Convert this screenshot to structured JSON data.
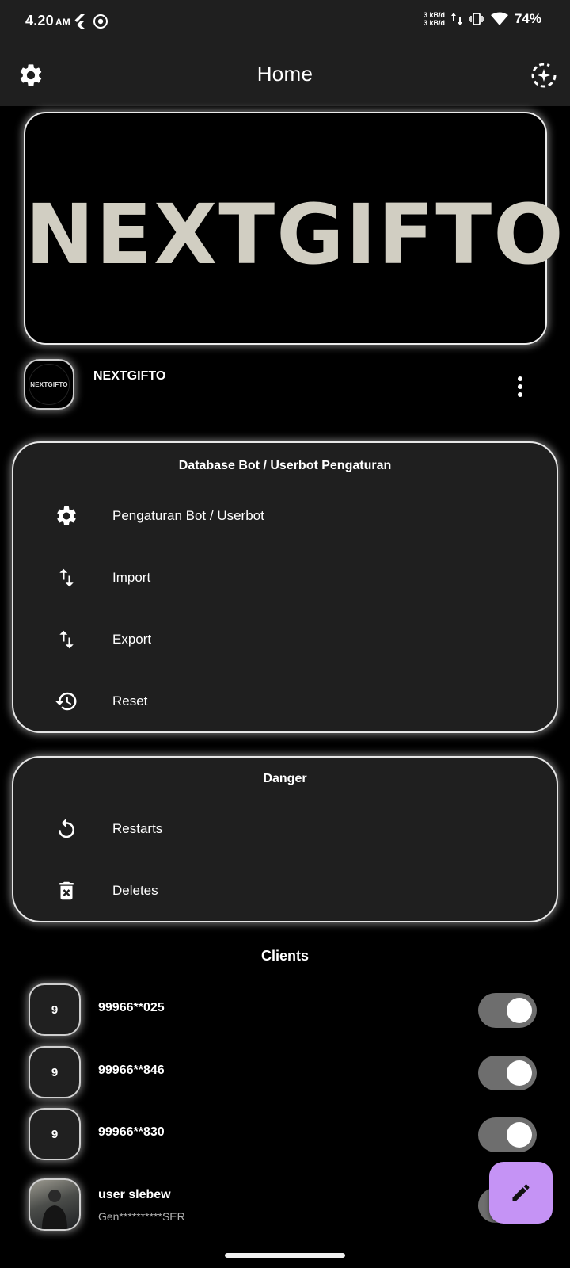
{
  "status_bar": {
    "time": "4.20",
    "ampm": "AM",
    "net_up": "3 kB/d",
    "net_down": "3 kB/d",
    "battery": "74%"
  },
  "app_bar": {
    "title": "Home",
    "left_icon": "settings-icon",
    "right_icon": "sparkle-refresh-icon"
  },
  "banner": {
    "logo_text": "NEXTGIFTO"
  },
  "profile": {
    "avatar_text": "NEXTGIFTO",
    "name": "NEXTGIFTO"
  },
  "database_card": {
    "title": "Database Bot / Userbot Pengaturan",
    "items": [
      {
        "label": "Pengaturan Bot / Userbot",
        "icon": "gear-icon"
      },
      {
        "label": "Import",
        "icon": "swap-vertical-icon"
      },
      {
        "label": "Export",
        "icon": "swap-vertical-icon"
      },
      {
        "label": "Reset",
        "icon": "history-icon"
      }
    ]
  },
  "danger_card": {
    "title": "Danger",
    "items": [
      {
        "label": "Restarts",
        "icon": "restart-icon"
      },
      {
        "label": "Deletes",
        "icon": "delete-icon"
      }
    ]
  },
  "clients": {
    "title": "Clients",
    "items": [
      {
        "badge": "9",
        "name": "99966**025",
        "sub": "",
        "enabled": true
      },
      {
        "badge": "9",
        "name": "99966**846",
        "sub": "",
        "enabled": true
      },
      {
        "badge": "9",
        "name": "99966**830",
        "sub": "",
        "enabled": true
      },
      {
        "badge": "",
        "name": "user slebew",
        "sub": "Gen**********SER",
        "enabled": true
      }
    ]
  },
  "fab": {
    "icon": "edit-pencil-icon"
  },
  "colors": {
    "background": "#000000",
    "surface": "#1f1f1f",
    "card_border": "#e6e6e6",
    "toggle_track": "#6e6e6e",
    "fab": "#c593f5"
  }
}
